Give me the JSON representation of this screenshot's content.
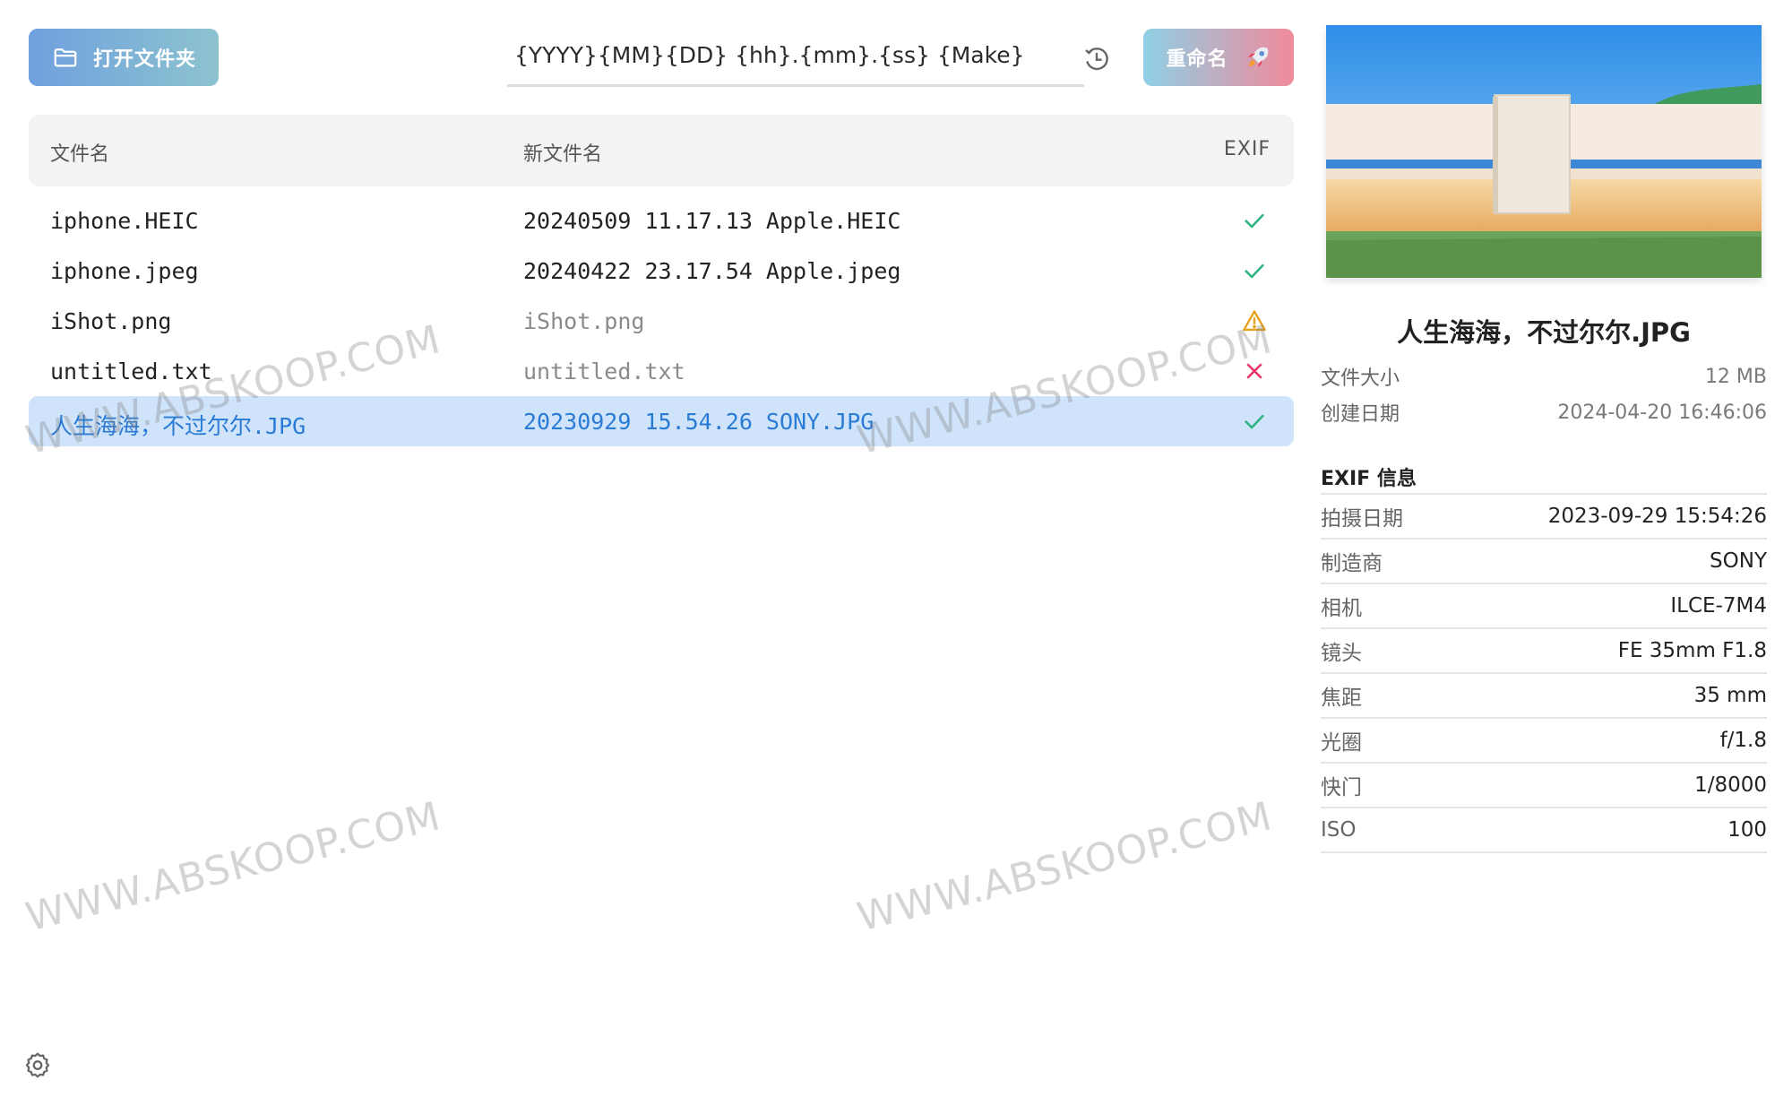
{
  "toolbar": {
    "open_folder_label": "打开文件夹",
    "template_value": "{YYYY}{MM}{DD} {hh}.{mm}.{ss} {Make}",
    "rename_label": "重命名"
  },
  "table": {
    "headers": {
      "filename": "文件名",
      "new_filename": "新文件名",
      "exif": "EXIF"
    },
    "rows": [
      {
        "name": "iphone.HEIC",
        "new_name": "20240509 11.17.13 Apple.HEIC",
        "status": "ok"
      },
      {
        "name": "iphone.jpeg",
        "new_name": "20240422 23.17.54 Apple.jpeg",
        "status": "ok"
      },
      {
        "name": "iShot.png",
        "new_name": "iShot.png",
        "status": "warning"
      },
      {
        "name": "untitled.txt",
        "new_name": "untitled.txt",
        "status": "error"
      },
      {
        "name": "人生海海，不过尔尔.JPG",
        "new_name": "20230929 15.54.26 SONY.JPG",
        "status": "ok"
      }
    ]
  },
  "panel": {
    "file_title": "人生海海，不过尔尔.JPG",
    "meta": [
      {
        "label": "文件大小",
        "value": "12 MB"
      },
      {
        "label": "创建日期",
        "value": "2024-04-20 16:46:06"
      }
    ],
    "exif_title": "EXIF 信息",
    "exif": [
      {
        "label": "拍摄日期",
        "value": "2023-09-29 15:54:26"
      },
      {
        "label": "制造商",
        "value": "SONY"
      },
      {
        "label": "相机",
        "value": "ILCE-7M4"
      },
      {
        "label": "镜头",
        "value": "FE 35mm F1.8"
      },
      {
        "label": "焦距",
        "value": "35 mm"
      },
      {
        "label": "光圈",
        "value": "f/1.8"
      },
      {
        "label": "快门",
        "value": "1/8000"
      },
      {
        "label": "ISO",
        "value": "100"
      }
    ]
  },
  "watermark": "WWW.ABSKOOP.COM",
  "colors": {
    "ok": "#2fb380",
    "warning": "#e6a11a",
    "error": "#e8366b",
    "selected_bg": "#cfe3fa",
    "selected_text": "#2a7bd6"
  }
}
